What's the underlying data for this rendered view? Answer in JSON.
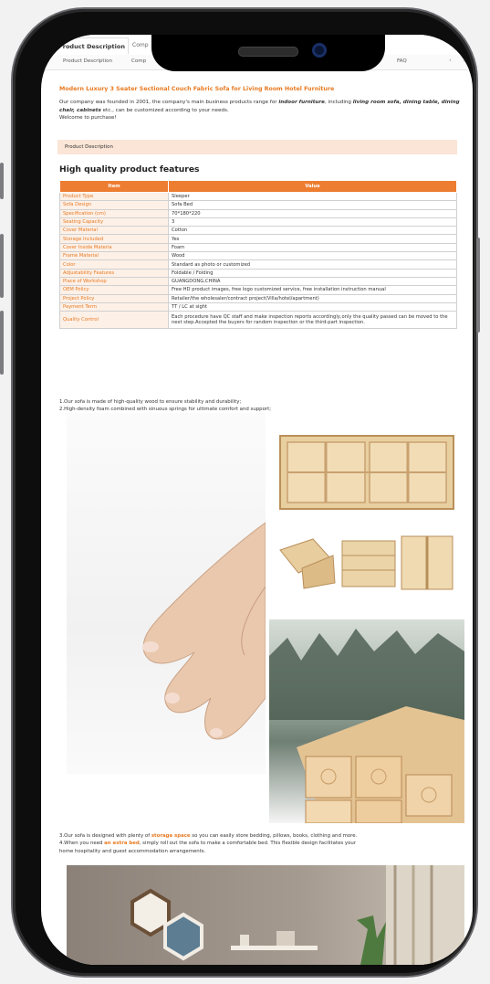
{
  "tabs": {
    "active": "Product Description",
    "partial": "Comp"
  },
  "nav": {
    "items": [
      "Product Description",
      "FAQ"
    ],
    "arrows": [
      "‹",
      "›"
    ]
  },
  "product_title": "Modern Luxury 3 Seater Sectional Couch Fabric Sofa for Living Room Hotel Furniture",
  "intro": {
    "p1_a": "Our company was founded in 2001, the company's main business products range for ",
    "p1_b": "indoor furniture",
    "p1_c": ", including ",
    "p1_d": "living room sofa, dining table, dining chair, cabinets",
    "p1_e": " etc., can be customized according to your needs.",
    "p2": "Welcome to purchase!"
  },
  "section_bar": "Product Description",
  "section_title": "High quality product features",
  "spec_table": {
    "headers": [
      "Item",
      "Value"
    ],
    "rows": [
      [
        "Product Type",
        "Sleeper"
      ],
      [
        "Sofa Design",
        "Sofa Bed"
      ],
      [
        "Specification (cm)",
        "70*180*220"
      ],
      [
        "Seating Capacity",
        "3"
      ],
      [
        "Cover Material",
        "Cotton"
      ],
      [
        "Storage Included",
        "Yes"
      ],
      [
        "Cover Inside Materia",
        "Foam"
      ],
      [
        "Frame Material",
        "Wood"
      ],
      [
        "Color",
        "Standard as photo or customized"
      ],
      [
        "Adjustability Features",
        "Foldable / Folding"
      ],
      [
        "Place of Workshop",
        "GUANGDONG,CHINA"
      ],
      [
        "OEM Policy",
        "Free HD product images, free logo customized service, free installation instruction manual"
      ],
      [
        "Project Policy",
        "Retailer/the wholesaler/contract project(Villa/hotel/apartment)"
      ],
      [
        "Payment Term",
        "TT / LC at sight"
      ],
      [
        "Quality Control",
        "Each procedure have QC staff and make inspection reports accordingly,only the quality passed can be moved to the next step.Accepted the buyers for random inspection or the third-part inspection."
      ]
    ]
  },
  "notes1": [
    "1.Our sofa is made of high-quality wood to ensure stability and durability;",
    "2.High-density foam combined with sinuous springs for ultimate comfort and support;"
  ],
  "notes2": {
    "l1_a": "3.Our sofa is designed with plenty of ",
    "l1_b": "storage space",
    "l1_c": " so you can easily store bedding, pillows, books, clothing and more.",
    "l2_a": "4.When you need ",
    "l2_b": "an extra bed",
    "l2_c": ", simply roll out the sofa to make a comfortable bed. This flexible design facilitates your",
    "l3": "home hospitality and guest accommodation arrangements."
  },
  "images": {
    "hand": "hand pressing foam",
    "frame": "wood frame",
    "wood": "wood beams",
    "room": "room with hexagon shelves"
  },
  "colors": {
    "accent": "#e77a22",
    "header": "#ed7d31",
    "bar": "#fbe5d6"
  }
}
